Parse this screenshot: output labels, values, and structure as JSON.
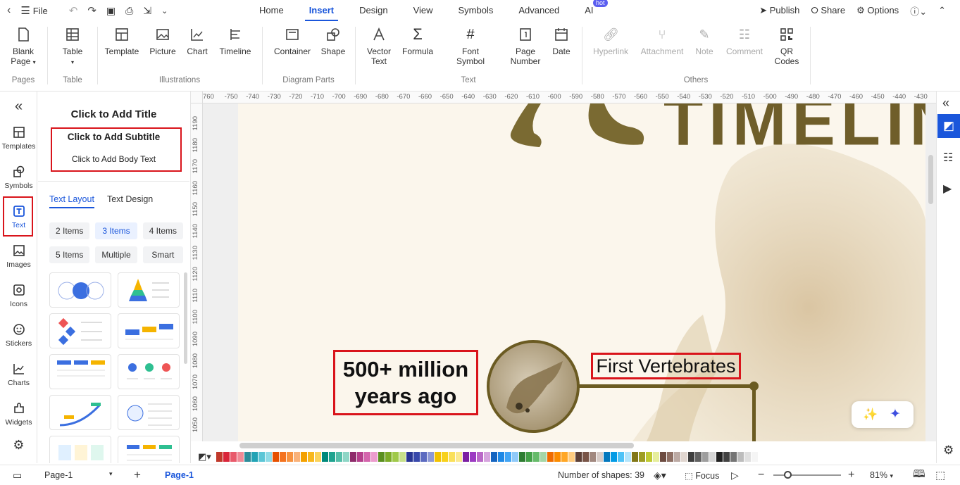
{
  "topbar": {
    "file_label": "File",
    "tabs": [
      "Home",
      "Insert",
      "Design",
      "View",
      "Symbols",
      "Advanced",
      "AI"
    ],
    "active_tab": "Insert",
    "ai_badge": "hot",
    "publish": "Publish",
    "share": "Share",
    "options": "Options"
  },
  "ribbon": {
    "pages": {
      "label": "Pages",
      "blank_page": "Blank\nPage"
    },
    "table": {
      "label": "Table",
      "table_btn": "Table"
    },
    "illustrations": {
      "label": "Illustrations",
      "template": "Template",
      "picture": "Picture",
      "chart": "Chart",
      "timeline": "Timeline"
    },
    "diagram_parts": {
      "label": "Diagram Parts",
      "container": "Container",
      "shape": "Shape"
    },
    "text": {
      "label": "Text",
      "vector_text": "Vector\nText",
      "formula": "Formula",
      "font_symbol": "Font\nSymbol",
      "page_number": "Page\nNumber",
      "date": "Date"
    },
    "others": {
      "label": "Others",
      "hyperlink": "Hyperlink",
      "attachment": "Attachment",
      "note": "Note",
      "comment": "Comment",
      "qr_codes": "QR\nCodes"
    }
  },
  "left_sidebar": {
    "items": [
      "Templates",
      "Symbols",
      "Text",
      "Images",
      "Icons",
      "Stickers",
      "Charts",
      "Widgets"
    ],
    "selected": "Text"
  },
  "panel": {
    "title": "Click to Add Title",
    "subtitle": "Click to Add Subtitle",
    "body": "Click to Add Body Text",
    "tabs": [
      "Text Layout",
      "Text Design"
    ],
    "active_tab": "Text Layout",
    "chips": [
      "2 Items",
      "3 Items",
      "4 Items",
      "5 Items",
      "Multiple",
      "Smart"
    ],
    "active_chip": "3 Items"
  },
  "ruler": {
    "top": [
      "760",
      "-750",
      "-740",
      "-730",
      "-720",
      "-710",
      "-700",
      "-690",
      "-680",
      "-670",
      "-660",
      "-650",
      "-640",
      "-630",
      "-620",
      "-610",
      "-600",
      "-590",
      "-580",
      "-570",
      "-560",
      "-550",
      "-540",
      "-530",
      "-520",
      "-510",
      "-500",
      "-490",
      "-480",
      "-470",
      "-460",
      "-450",
      "-440",
      "-430"
    ],
    "left": [
      "1190",
      "1180",
      "1170",
      "1160",
      "1150",
      "1140",
      "1130",
      "1120",
      "1110",
      "1100",
      "1090",
      "1080",
      "1070",
      "1060",
      "1050"
    ]
  },
  "canvas": {
    "headline_fragment": "TIMELIN",
    "date_box": "500+ million years ago",
    "event_label": "First Vertebrates"
  },
  "palette": {
    "colors": [
      "#c0392b",
      "#d9263a",
      "#e85a6b",
      "#f08a96",
      "#2c8c99",
      "#22a3b5",
      "#5cc6d6",
      "#8fdbe6",
      "#e65100",
      "#f4731f",
      "#f7923f",
      "#f9b27a",
      "#f4a100",
      "#f8b81c",
      "#fbd35a",
      "#00897b",
      "#1fa38f",
      "#54bea9",
      "#8ed6c6",
      "#8e2c6b",
      "#b43e8b",
      "#d465ad",
      "#ec9ccd",
      "#5a8f1f",
      "#7cab27",
      "#a0c94a",
      "#c7e08a",
      "#283593",
      "#3949ab",
      "#5c6bc0",
      "#8e99d6",
      "#f2c200",
      "#f7d11c",
      "#fae05a",
      "#fbe98f",
      "#7b1fa2",
      "#9c3bc2",
      "#ba68c8",
      "#d6a4de",
      "#1565c0",
      "#1e88e5",
      "#42a5f5",
      "#90caf9",
      "#2e7d32",
      "#43a047",
      "#66bb6a",
      "#a5d6a7",
      "#ef6c00",
      "#fb8c00",
      "#ffa726",
      "#ffcc80",
      "#5d4037",
      "#795548",
      "#a1887f",
      "#d7ccc8",
      "#0277bd",
      "#039be5",
      "#4fc3f7",
      "#b3e5fc",
      "#827717",
      "#9e9d24",
      "#c0ca33",
      "#e6ee9c",
      "#6d4c41",
      "#8d6e63",
      "#bcaaa4",
      "#e0d6d0",
      "#3e3e3e",
      "#616161",
      "#9e9e9e",
      "#d6d6d6",
      "#212121",
      "#424242",
      "#757575",
      "#bdbdbd",
      "#e0e0e0",
      "#f5f5f5"
    ]
  },
  "status": {
    "page_select": "Page-1",
    "active_page": "Page-1",
    "shapes": "Number of shapes: 39",
    "focus": "Focus",
    "zoom": "81%"
  }
}
